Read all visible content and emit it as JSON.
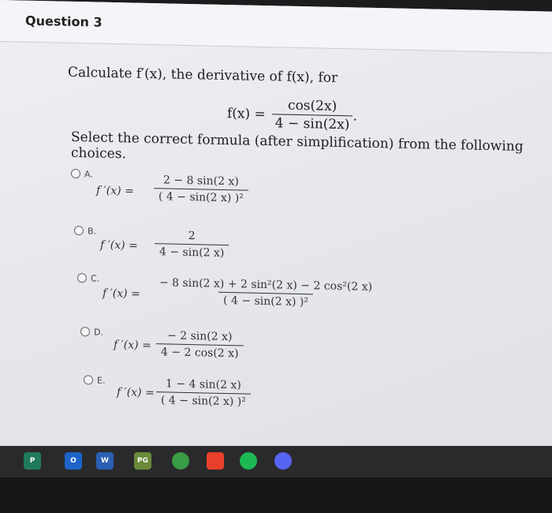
{
  "question": {
    "title": "Question 3",
    "prompt": "Calculate f′(x), the derivative of f(x), for",
    "function_lhs": "f(x) =",
    "function_num": "cos(2x)",
    "function_den": "4 − sin(2x)",
    "function_end": ".",
    "instruction": "Select the correct formula (after simplification) from the following choices."
  },
  "options": [
    {
      "letter": "A.",
      "lhs": "f ′(x) =",
      "num": "2 − 8 sin(2 x)",
      "den": "( 4 − sin(2 x) )²"
    },
    {
      "letter": "B.",
      "lhs": "f ′(x) =",
      "num": "2",
      "den": "4 − sin(2 x)"
    },
    {
      "letter": "C.",
      "lhs": "f ′(x) =",
      "num": "− 8 sin(2 x) + 2 sin²(2 x) − 2 cos²(2 x)",
      "den": "( 4 − sin(2 x) )²"
    },
    {
      "letter": "D.",
      "lhs": "f ′(x) =",
      "num": "− 2 sin(2 x)",
      "den": "4 − 2 cos(2 x)"
    },
    {
      "letter": "E.",
      "lhs": "f ′(x) =",
      "num": "1 − 4 sin(2 x)",
      "den": "( 4 − sin(2 x) )²"
    }
  ],
  "taskbar": {
    "apps": [
      {
        "name": "publisher-icon",
        "label": "P",
        "color": "#1f7a5c"
      },
      {
        "name": "outlook-icon",
        "label": "O",
        "color": "#1e64c8"
      },
      {
        "name": "word-icon",
        "label": "W",
        "color": "#2b5fb4"
      },
      {
        "name": "photos-icon",
        "label": "PG",
        "color": "#6a8a3a"
      },
      {
        "name": "chrome-icon",
        "label": "",
        "color": "#3a9b45"
      },
      {
        "name": "pointer-icon",
        "label": "",
        "color": "#e8402a"
      },
      {
        "name": "spotify-icon",
        "label": "",
        "color": "#1db954"
      },
      {
        "name": "discord-icon",
        "label": "",
        "color": "#5865f2"
      }
    ]
  }
}
